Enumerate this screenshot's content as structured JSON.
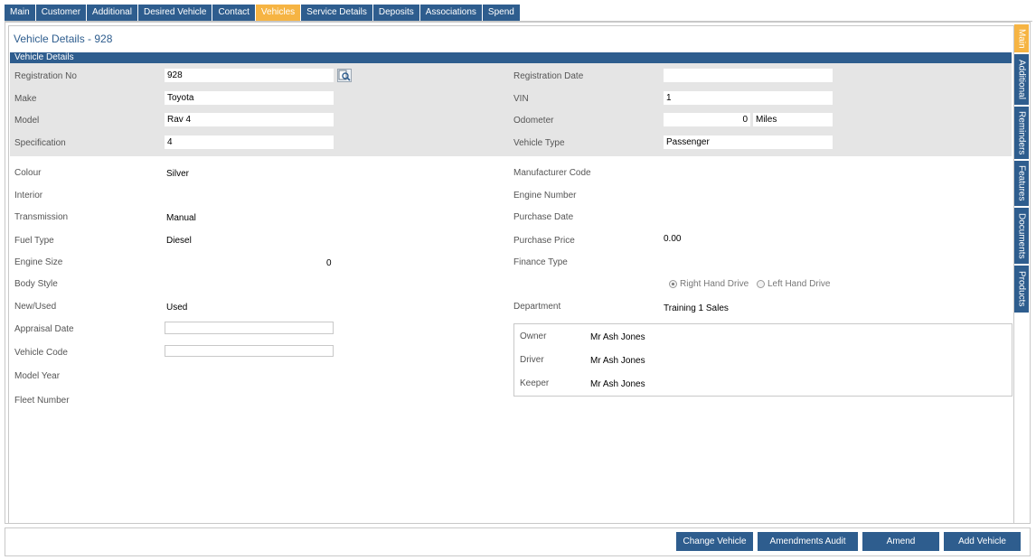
{
  "tabs": [
    "Main",
    "Customer",
    "Additional",
    "Desired Vehicle",
    "Contact",
    "Vehicles",
    "Service Details",
    "Deposits",
    "Associations",
    "Spend"
  ],
  "active_tab": "Vehicles",
  "page_title": "Vehicle Details - 928",
  "section_title": "Vehicle Details",
  "fields": {
    "registration_no": {
      "label": "Registration No",
      "value": "928"
    },
    "make": {
      "label": "Make",
      "value": "Toyota"
    },
    "model": {
      "label": "Model",
      "value": "Rav 4"
    },
    "specification": {
      "label": "Specification",
      "value": "4"
    },
    "registration_date": {
      "label": "Registration Date",
      "value": ""
    },
    "vin": {
      "label": "VIN",
      "value": "1"
    },
    "odometer": {
      "label": "Odometer",
      "value": "0",
      "unit": "Miles"
    },
    "vehicle_type": {
      "label": "Vehicle Type",
      "value": "Passenger"
    },
    "colour": {
      "label": "Colour",
      "value": "Silver"
    },
    "interior": {
      "label": "Interior",
      "value": ""
    },
    "transmission": {
      "label": "Transmission",
      "value": "Manual"
    },
    "fuel_type": {
      "label": "Fuel Type",
      "value": "Diesel"
    },
    "engine_size": {
      "label": "Engine Size",
      "value": "0"
    },
    "body_style": {
      "label": "Body Style",
      "value": ""
    },
    "new_used": {
      "label": "New/Used",
      "value": "Used"
    },
    "appraisal_date": {
      "label": "Appraisal Date",
      "value": ""
    },
    "vehicle_code": {
      "label": "Vehicle Code",
      "value": ""
    },
    "model_year": {
      "label": "Model Year",
      "value": ""
    },
    "fleet_number": {
      "label": "Fleet Number",
      "value": ""
    },
    "manufacturer_code": {
      "label": "Manufacturer Code",
      "value": ""
    },
    "engine_number": {
      "label": "Engine Number",
      "value": ""
    },
    "purchase_date": {
      "label": "Purchase Date",
      "value": ""
    },
    "purchase_price": {
      "label": "Purchase Price",
      "value": "0.00"
    },
    "finance_type": {
      "label": "Finance Type",
      "value": ""
    },
    "department": {
      "label": "Department",
      "value": "Training 1 Sales"
    }
  },
  "drive": {
    "right": "Right Hand Drive",
    "left": "Left Hand Drive",
    "selected": "right"
  },
  "owner": {
    "label": "Owner",
    "value": "Mr Ash Jones"
  },
  "driver": {
    "label": "Driver",
    "value": "Mr Ash Jones"
  },
  "keeper": {
    "label": "Keeper",
    "value": "Mr Ash Jones"
  },
  "side_tabs": [
    "Main",
    "Additional",
    "Reminders",
    "Features",
    "Documents",
    "Products"
  ],
  "active_side_tab": "Main",
  "buttons": {
    "change_vehicle": "Change Vehicle",
    "amendments_audit": "Amendments Audit",
    "amend": "Amend",
    "add_vehicle": "Add Vehicle"
  },
  "colors": {
    "primary": "#2e5d8e",
    "active_tab": "#f6b443",
    "band": "#e5e5e5"
  }
}
